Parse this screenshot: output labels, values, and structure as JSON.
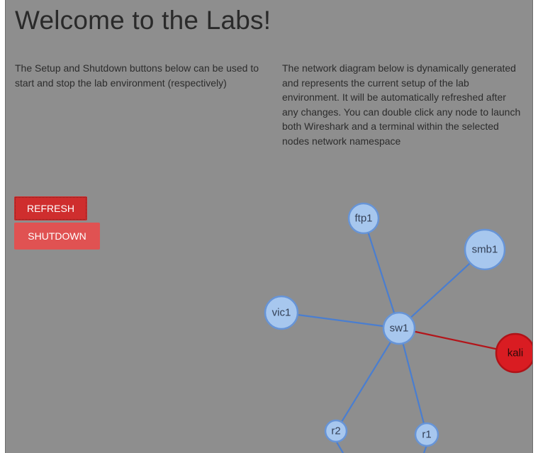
{
  "page": {
    "title": "Welcome to the Labs!"
  },
  "intro": {
    "left": "The Setup and Shutdown buttons below can be used to start and stop the lab environment (respectively)",
    "right": "The network diagram below is dynamically generated and represents the current setup of the lab environment. It will be automatically refreshed after any changes. You can double click any node to launch both Wireshark and a terminal within the selected nodes network namespace"
  },
  "buttons": {
    "refresh_label": "REFRESH",
    "shutdown_label": "SHUTDOWN"
  },
  "network": {
    "colors": {
      "node_fill": "#a7c7ee",
      "node_stroke": "#6794d6",
      "edge": "#4a7ed0",
      "attacker_fill": "#d91c22",
      "attacker_stroke": "#b01217",
      "attacker_edge": "#b3151a"
    },
    "nodes": [
      {
        "id": "sw1",
        "label": "sw1"
      },
      {
        "id": "ftp1",
        "label": "ftp1"
      },
      {
        "id": "smb1",
        "label": "smb1"
      },
      {
        "id": "vic1",
        "label": "vic1"
      },
      {
        "id": "kali",
        "label": "kali",
        "attacker": true
      },
      {
        "id": "r2",
        "label": "r2"
      },
      {
        "id": "r1",
        "label": "r1"
      }
    ],
    "edges": [
      {
        "from": "sw1",
        "to": "ftp1"
      },
      {
        "from": "sw1",
        "to": "smb1"
      },
      {
        "from": "sw1",
        "to": "vic1"
      },
      {
        "from": "sw1",
        "to": "kali",
        "attacker": true
      },
      {
        "from": "sw1",
        "to": "r2"
      },
      {
        "from": "sw1",
        "to": "r1"
      }
    ]
  }
}
